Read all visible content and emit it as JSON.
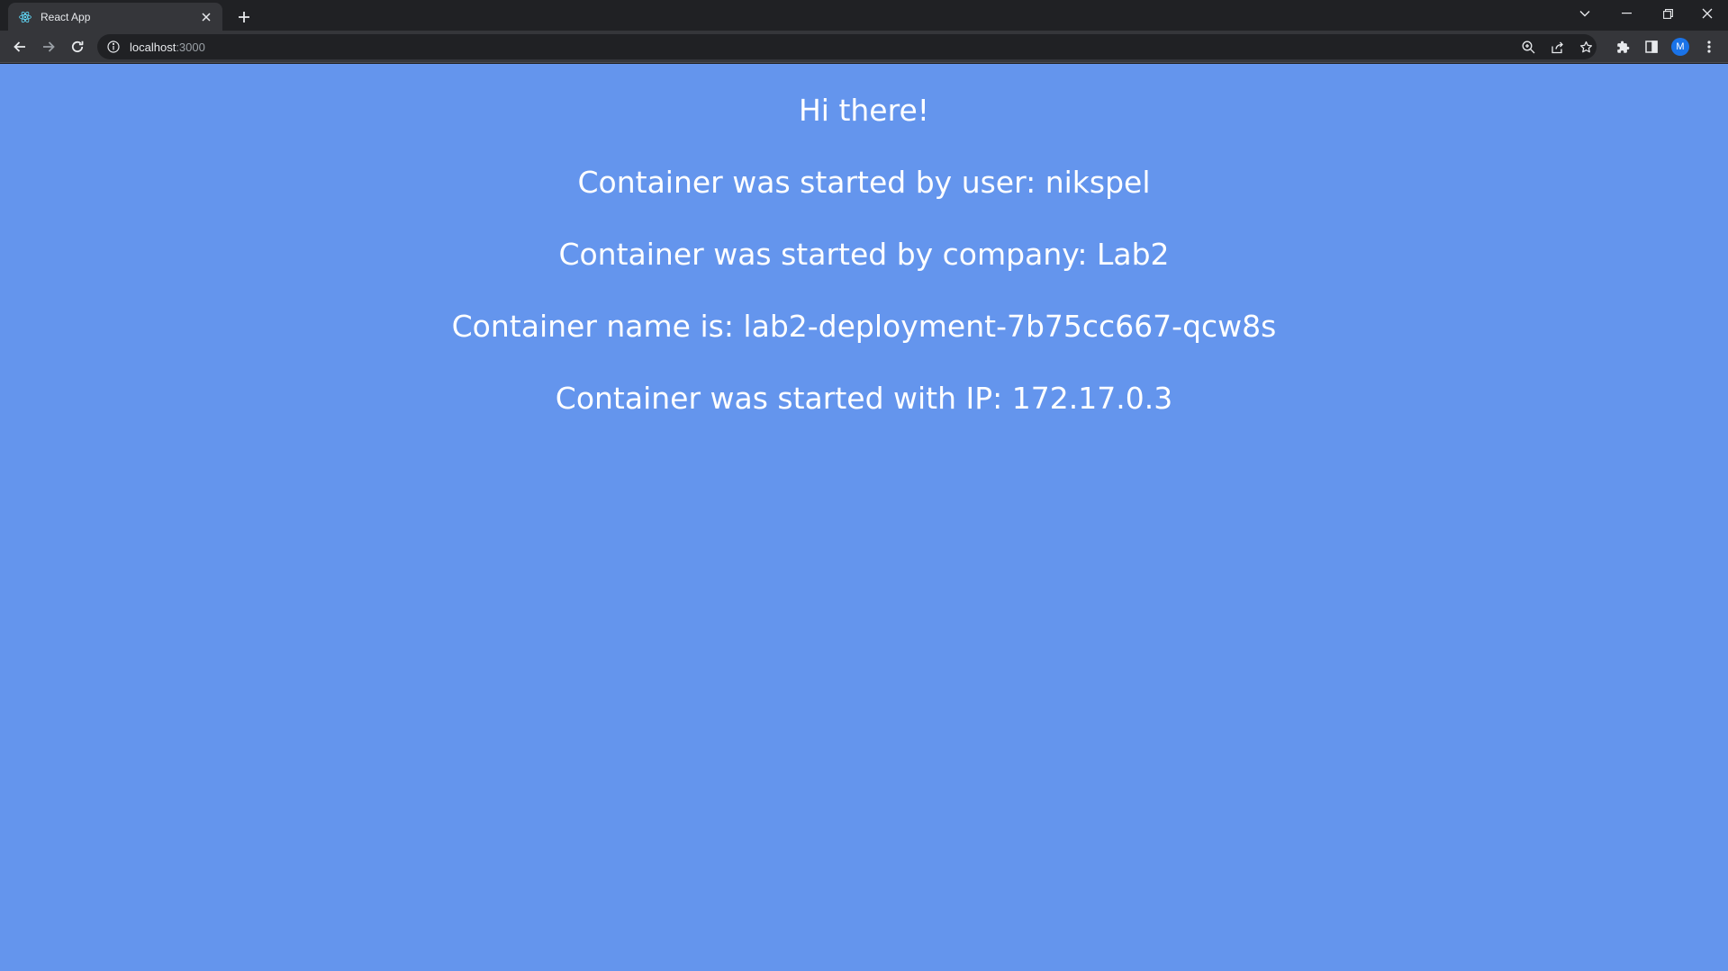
{
  "browser": {
    "tab": {
      "title": "React App",
      "favicon": "react-logo-icon"
    },
    "address": {
      "host": "localhost",
      "port": ":3000"
    },
    "profile_initial": "M",
    "colors": {
      "frame": "#202124",
      "toolbar": "#35363a",
      "icon": "#e8eaed"
    }
  },
  "page": {
    "background": "#6495ed",
    "text_color": "#ffffff",
    "lines": [
      "Hi there!",
      "Container was started by user: nikspel",
      "Container was started by company: Lab2",
      "Container name is: lab2-deployment-7b75cc667-qcw8s",
      "Container was started with IP: 172.17.0.3"
    ]
  }
}
